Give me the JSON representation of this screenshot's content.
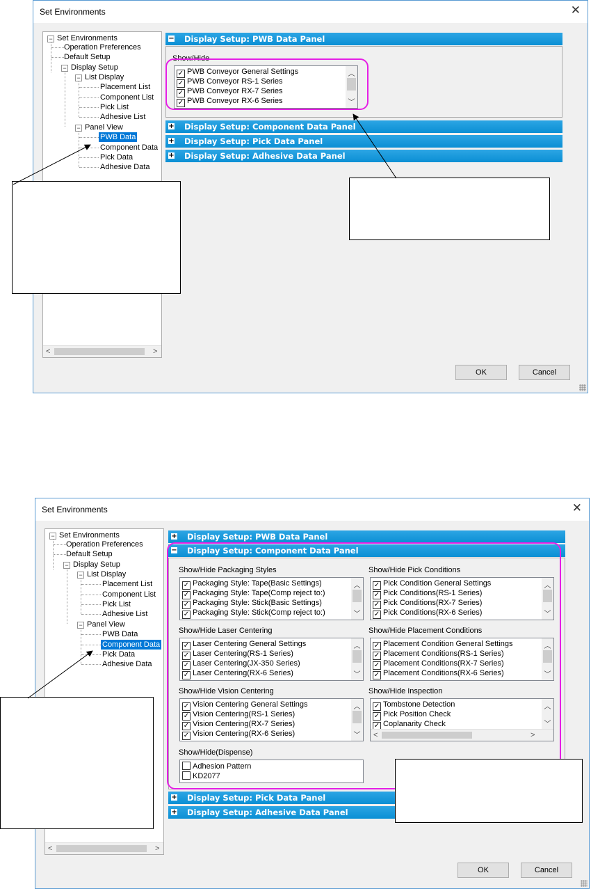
{
  "dialogs": [
    {
      "title": "Set Environments",
      "tree": {
        "root": "Set Environments",
        "operation_preferences": "Operation Preferences",
        "default_setup": "Default Setup",
        "display_setup": "Display Setup",
        "list_display": "List Display",
        "placement_list": "Placement List",
        "component_list": "Component List",
        "pick_list": "Pick List",
        "adhesive_list": "Adhesive List",
        "panel_view": "Panel View",
        "pwb_data": "PWB Data",
        "component_data": "Component Data",
        "pick_data": "Pick Data",
        "adhesive_data": "Adhesive Data",
        "selected": "PWB Data"
      },
      "panels": [
        {
          "label": "Display Setup: PWB Data Panel",
          "expanded": true
        },
        {
          "label": "Display Setup: Component Data Panel",
          "expanded": false
        },
        {
          "label": "Display Setup: Pick Data Panel",
          "expanded": false
        },
        {
          "label": "Display Setup: Adhesive Data Panel",
          "expanded": false
        }
      ],
      "show_hide": {
        "label": "Show/Hide",
        "items": [
          {
            "label": "PWB Conveyor General Settings",
            "checked": true
          },
          {
            "label": "PWB Conveyor RS-1 Series",
            "checked": true
          },
          {
            "label": "PWB Conveyor RX-7 Series",
            "checked": true
          },
          {
            "label": "PWB Conveyor RX-6 Series",
            "checked": true
          }
        ]
      },
      "ok_label": "OK",
      "cancel_label": "Cancel"
    },
    {
      "title": "Set Environments",
      "tree": {
        "root": "Set Environments",
        "operation_preferences": "Operation Preferences",
        "default_setup": "Default Setup",
        "display_setup": "Display Setup",
        "list_display": "List Display",
        "placement_list": "Placement List",
        "component_list": "Component List",
        "pick_list": "Pick List",
        "adhesive_list": "Adhesive List",
        "panel_view": "Panel View",
        "pwb_data": "PWB Data",
        "component_data": "Component Data",
        "pick_data": "Pick Data",
        "adhesive_data": "Adhesive Data",
        "selected": "Component Data"
      },
      "panels": [
        {
          "label": "Display Setup: PWB Data Panel",
          "expanded": false
        },
        {
          "label": "Display Setup: Component Data Panel",
          "expanded": true
        },
        {
          "label": "Display Setup: Pick Data Panel",
          "expanded": false
        },
        {
          "label": "Display Setup: Adhesive Data Panel",
          "expanded": false
        }
      ],
      "groups": {
        "packaging": {
          "label": "Show/Hide Packaging Styles",
          "items": [
            {
              "label": "Packaging Style: Tape(Basic Settings)",
              "checked": true
            },
            {
              "label": "Packaging Style: Tape(Comp reject to:)",
              "checked": true
            },
            {
              "label": "Packaging Style: Stick(Basic Settings)",
              "checked": true
            },
            {
              "label": "Packaging Style: Stick(Comp reject to:)",
              "checked": true
            }
          ]
        },
        "pick": {
          "label": "Show/Hide Pick Conditions",
          "items": [
            {
              "label": "Pick Condition General Settings",
              "checked": true
            },
            {
              "label": "Pick Conditions(RS-1 Series)",
              "checked": true
            },
            {
              "label": "Pick Conditions(RX-7 Series)",
              "checked": true
            },
            {
              "label": "Pick Conditions(RX-6 Series)",
              "checked": true
            }
          ]
        },
        "laser": {
          "label": "Show/Hide Laser Centering",
          "items": [
            {
              "label": "Laser Centering General Settings",
              "checked": true
            },
            {
              "label": "Laser Centering(RS-1 Series)",
              "checked": true
            },
            {
              "label": "Laser Centering(JX-350 Series)",
              "checked": true
            },
            {
              "label": "Laser Centering(RX-6 Series)",
              "checked": true
            }
          ]
        },
        "placement": {
          "label": "Show/Hide Placement Conditions",
          "items": [
            {
              "label": "Placement Condition General Settings",
              "checked": true
            },
            {
              "label": "Placement Conditions(RS-1 Series)",
              "checked": true
            },
            {
              "label": "Placement Conditions(RX-7 Series)",
              "checked": true
            },
            {
              "label": "Placement Conditions(RX-6 Series)",
              "checked": true
            }
          ]
        },
        "vision": {
          "label": "Show/Hide Vision Centering",
          "items": [
            {
              "label": "Vision Centering General Settings",
              "checked": true
            },
            {
              "label": "Vision Centering(RS-1 Series)",
              "checked": true
            },
            {
              "label": "Vision Centering(RX-7 Series)",
              "checked": true
            },
            {
              "label": "Vision Centering(RX-6 Series)",
              "checked": true
            }
          ]
        },
        "inspection": {
          "label": "Show/Hide Inspection",
          "items": [
            {
              "label": "Tombstone Detection",
              "checked": true
            },
            {
              "label": "Pick Position Check",
              "checked": true
            },
            {
              "label": "Coplanarity Check",
              "checked": true
            }
          ]
        },
        "dispense": {
          "label": "Show/Hide(Dispense)",
          "items": [
            {
              "label": "Adhesion Pattern",
              "checked": false
            },
            {
              "label": "KD2077",
              "checked": false
            }
          ]
        }
      },
      "ok_label": "OK",
      "cancel_label": "Cancel"
    }
  ],
  "icons": {
    "close": "close-icon",
    "check": "check-icon",
    "scroll_up": "chevron-up-icon",
    "scroll_down": "chevron-down-icon",
    "scroll_left": "chevron-left-icon",
    "scroll_right": "chevron-right-icon",
    "expand": "plus-icon",
    "collapse": "minus-icon"
  },
  "colors": {
    "panel_header": "#0b8fd4",
    "highlight": "#e51ee5",
    "selection": "#0078d7"
  }
}
